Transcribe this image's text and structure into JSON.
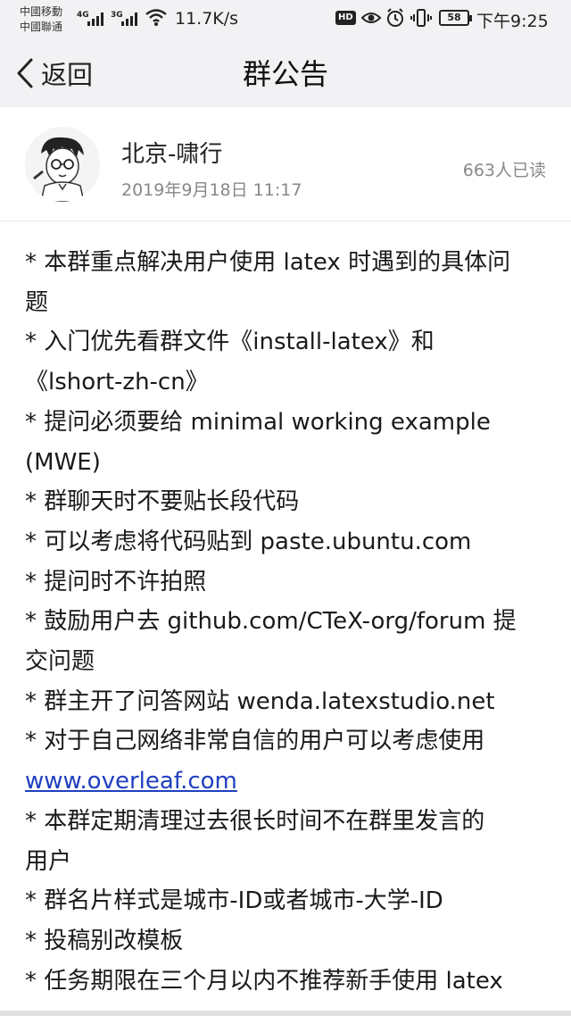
{
  "status_bar": {
    "carrier_1": "中國移動",
    "carrier_2": "中國聯通",
    "signal_1_type": "4G",
    "signal_2_type": "3G",
    "network_speed": "11.7K/s",
    "hd_badge": "HD",
    "battery_level": "58",
    "time": "下午9:25",
    "icons": [
      "signal-icon",
      "wifi-icon",
      "eye-icon",
      "alarm-icon",
      "vibrate-icon",
      "battery-icon"
    ]
  },
  "nav": {
    "back_label": "返回",
    "title": "群公告"
  },
  "author": {
    "name": "北京-啸行",
    "timestamp": "2019年9月18日 11:17",
    "read_count": "663人已读"
  },
  "notice_lines": [
    "* 本群重点解决用户使用 latex 时遇到的具体问",
    "题",
    "* 入门优先看群文件《install-latex》和",
    "《lshort-zh-cn》",
    "* 提问必须要给 minimal working example",
    "(MWE)",
    "* 群聊天时不要贴长段代码",
    "* 可以考虑将代码贴到 paste.ubuntu.com",
    "* 提问时不许拍照",
    "* 鼓励用户去 github.com/CTeX-org/forum 提",
    "交问题",
    "* 群主开了问答网站 wenda.latexstudio.net",
    "* 对于自己网络非常自信的用户可以考虑使用",
    "www.overleaf.com",
    "* 本群定期清理过去很长时间不在群里发言的",
    "用户",
    "* 群名片样式是城市-ID或者城市-大学-ID",
    "* 投稿别改模板",
    "* 任务期限在三个月以内不推荐新手使用 latex"
  ],
  "colors": {
    "header_bg": "#f2f2f4",
    "link": "#1f3fbf",
    "secondary_text": "#888888"
  }
}
